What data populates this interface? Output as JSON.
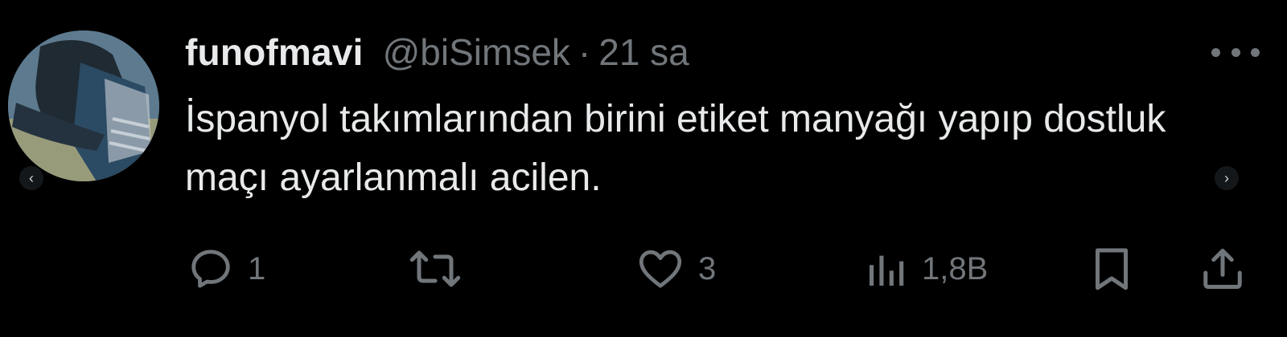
{
  "tweet": {
    "display_name": "funofmavi",
    "handle": "@biSimsek",
    "separator": "·",
    "time": "21 sa",
    "text": "İspanyol takımlarından birini etiket manyağı yapıp dostluk maçı ayarlanmalı acilen."
  },
  "actions": {
    "reply_count": "1",
    "retweet_count": "",
    "like_count": "3",
    "view_count": "1,8B"
  },
  "nav": {
    "prev_glyph": "‹",
    "next_glyph": "›"
  },
  "icons": {
    "reply": "reply-icon",
    "retweet": "retweet-icon",
    "like": "heart-icon",
    "views": "views-icon",
    "bookmark": "bookmark-icon",
    "share": "share-icon",
    "more": "more-icon"
  },
  "colors": {
    "background": "#000000",
    "primary_text": "#e7e9ea",
    "secondary_text": "#71767b"
  }
}
